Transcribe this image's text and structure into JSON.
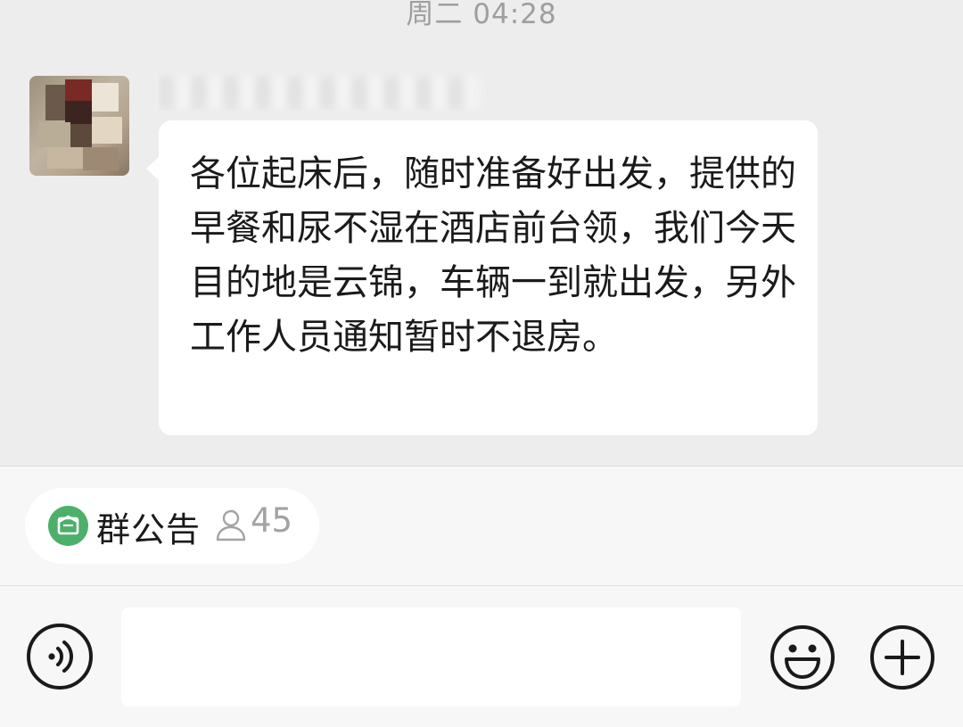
{
  "chat": {
    "timestamp": "周二 04:28",
    "message": {
      "sender_name": "",
      "text": "各位起床后，随时准备好出发，提供的早餐和尿不湿在酒店前台领，我们今天目的地是云锦，车辆一到就出发，另外工作人员通知暂时不退房。"
    }
  },
  "notice": {
    "label": "群公告",
    "member_count": "45",
    "icon": "announcement-icon",
    "count_icon": "person-icon"
  },
  "input_bar": {
    "placeholder": "",
    "voice_icon": "voice-icon",
    "emoji_icon": "emoji-icon",
    "plus_icon": "plus-icon"
  },
  "colors": {
    "chat_bg": "#ededed",
    "bubble_bg": "#ffffff",
    "notice_icon_bg": "#4caf6a",
    "toolbar_bg": "#f7f7f7"
  }
}
